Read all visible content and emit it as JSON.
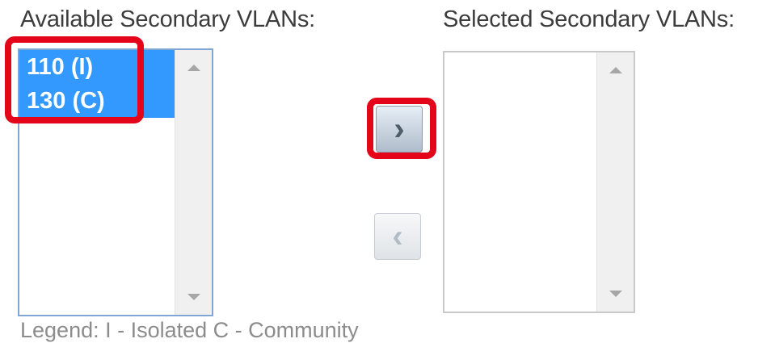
{
  "available": {
    "label": "Available Secondary VLANs:",
    "options": [
      "110 (I)",
      "130 (C)"
    ]
  },
  "selected": {
    "label": "Selected Secondary VLANs:",
    "options": []
  },
  "buttons": {
    "move_right": "›",
    "move_left": "‹"
  },
  "legend": "Legend: I - Isolated C - Community",
  "colors": {
    "selection": "#3399ff",
    "highlight": "#e5051a"
  }
}
